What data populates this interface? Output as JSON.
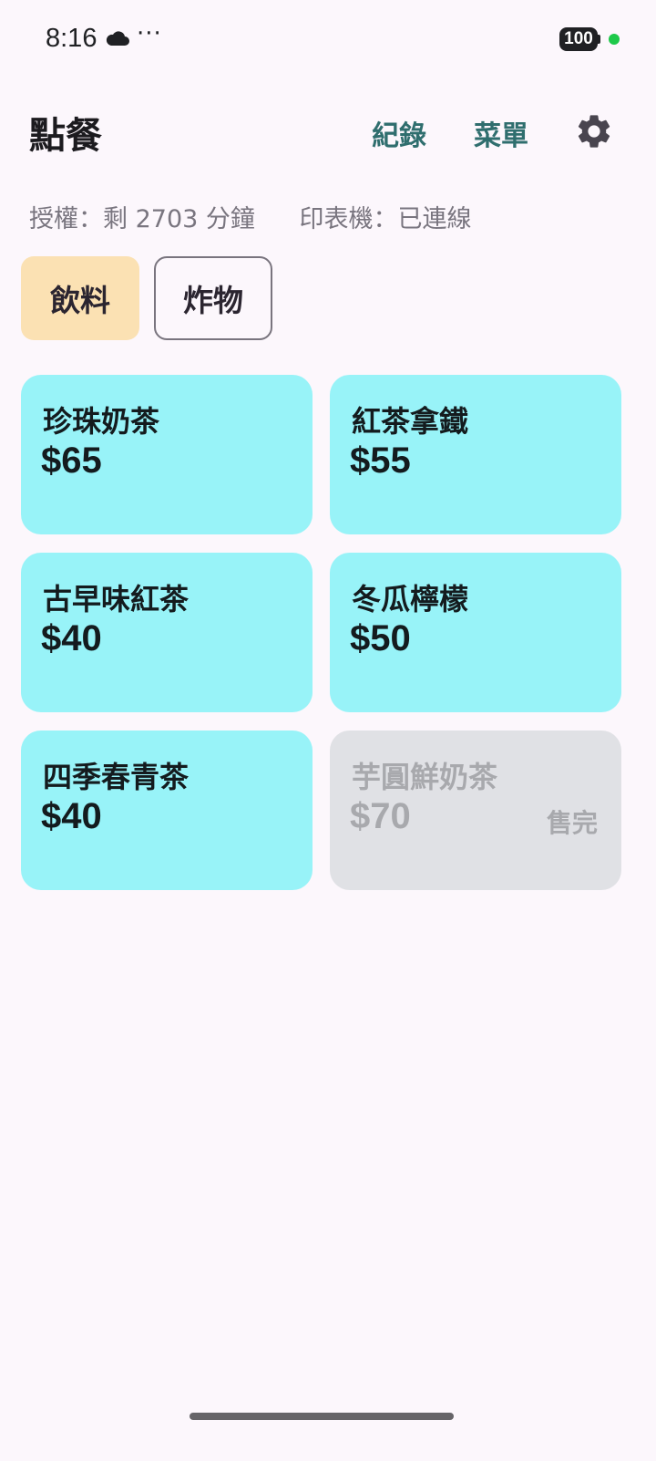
{
  "status_bar": {
    "time": "8:16",
    "more": "···",
    "battery": "100",
    "icons": [
      "cloud-icon",
      "more-dots-icon",
      "battery-icon",
      "privacy-indicator-dot"
    ]
  },
  "header": {
    "title": "點餐",
    "records_label": "紀錄",
    "menu_label": "菜單",
    "settings_icon": "gear-icon"
  },
  "info": {
    "license": "授權：剩 2703 分鐘",
    "printer": "印表機：已連線"
  },
  "tabs": [
    {
      "label": "飲料",
      "selected": true
    },
    {
      "label": "炸物",
      "selected": false
    }
  ],
  "items": [
    {
      "name": "珍珠奶茶",
      "price": "$65",
      "sold_out": false
    },
    {
      "name": "紅茶拿鐵",
      "price": "$55",
      "sold_out": false
    },
    {
      "name": "古早味紅茶",
      "price": "$40",
      "sold_out": false
    },
    {
      "name": "冬瓜檸檬",
      "price": "$50",
      "sold_out": false
    },
    {
      "name": "四季春青茶",
      "price": "$40",
      "sold_out": false
    },
    {
      "name": "芋圓鮮奶茶",
      "price": "$70",
      "sold_out": true,
      "badge": "售完"
    }
  ],
  "colors": {
    "background": "#fcf7fc",
    "item_card": "#98f3f8",
    "sold_out_card": "#e0e1e5",
    "active_tab": "#fbe1b3",
    "link": "#2f6e6e",
    "secondary_text": "#79757f"
  }
}
